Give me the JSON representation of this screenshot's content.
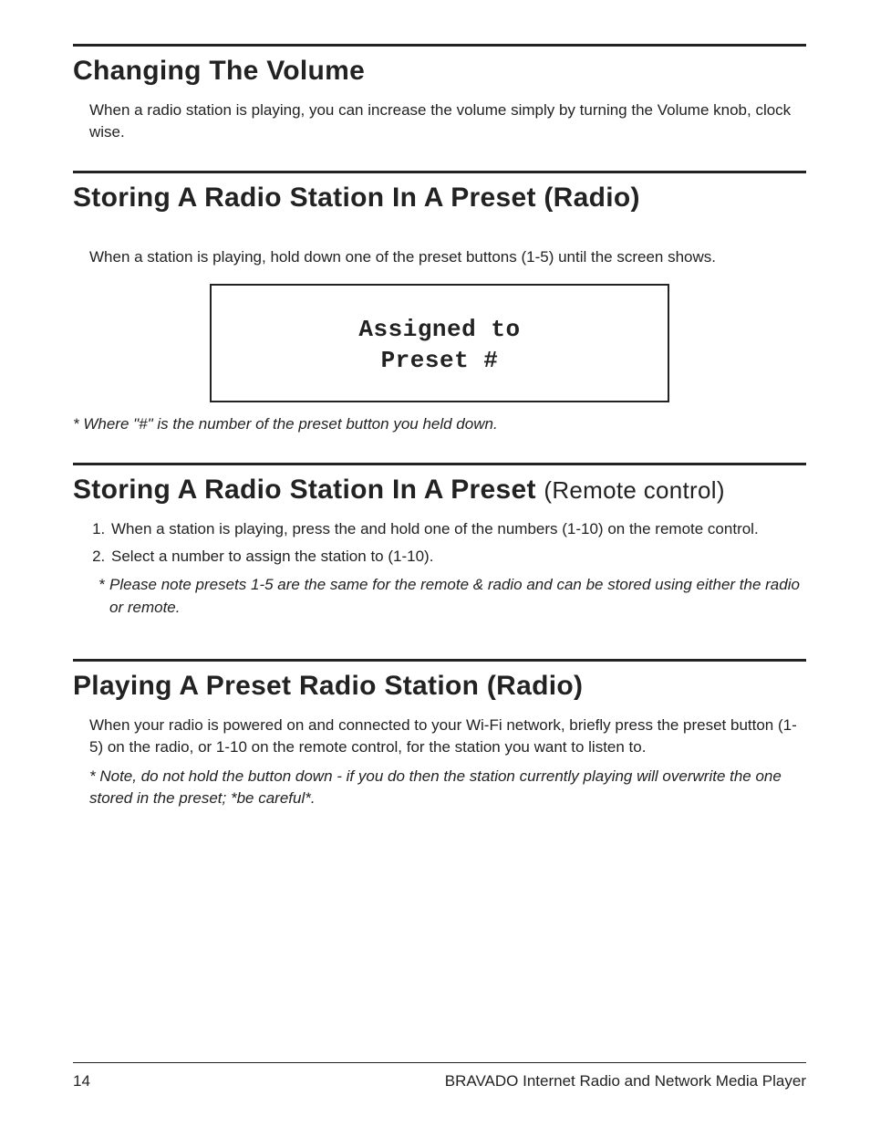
{
  "sections": {
    "volume": {
      "heading": "Changing The Volume",
      "body": "When a radio station is playing, you can increase the volume simply by turning the Volume knob, clock wise."
    },
    "store_radio": {
      "heading": "Storing A Radio Station In A Preset (Radio)",
      "body": "When a station is playing, hold down one of the preset buttons (1-5) until the screen shows.",
      "screen_line1": "Assigned to",
      "screen_line2": "Preset #",
      "note": "* Where \"#\" is the number of the preset button you held down."
    },
    "store_remote": {
      "heading_main": "Storing A Radio Station In A Preset ",
      "heading_paren": "(Remote control)",
      "steps": [
        "When a station is playing, press the and hold one of the numbers (1-10) on the remote control.",
        "Select a number to assign the station to (1-10)."
      ],
      "note": "Please note presets 1-5 are the same for the remote & radio and can be stored using either the radio or remote."
    },
    "play_preset": {
      "heading": "Playing A Preset Radio Station (Radio)",
      "body": "When your radio is powered on and connected to your Wi-Fi network, briefly press the preset button (1-5) on the radio, or 1-10 on the remote control, for the station you want to listen to.",
      "note": "* Note, do not hold the button down - if you do then the station currently playing will overwrite the one stored in the preset; *be careful*."
    }
  },
  "footer": {
    "page_number": "14",
    "title": "BRAVADO Internet Radio and Network Media Player"
  }
}
